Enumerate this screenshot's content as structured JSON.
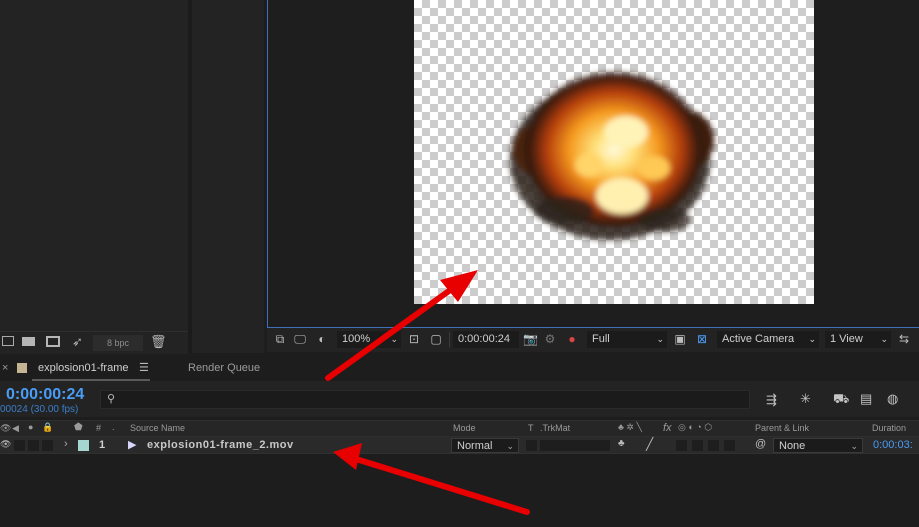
{
  "project": {
    "bit_depth": "8 bpc"
  },
  "viewer": {
    "zoom": "100%",
    "timecode": "0:00:00:24",
    "resolution": "Full",
    "camera": "Active Camera",
    "views": "1 View"
  },
  "timeline": {
    "close_glyph": "×",
    "comp_tab": "explosion01-frame",
    "render_queue_tab": "Render Queue",
    "menu_glyph": "☰",
    "current_time": "0:00:00:24",
    "frame_info": "00024 (30.00 fps)",
    "search_placeholder": "",
    "columns": {
      "hash": "#",
      "dot": ".",
      "source_name": "Source Name",
      "mode": "Mode",
      "t": "T",
      "trkmat": ".TrkMat",
      "fx": "fx",
      "parent_link": "Parent & Link",
      "duration": "Duration"
    },
    "layer": {
      "index": "1",
      "name": "explosion01-frame_2.mov",
      "mode": "Normal",
      "parent": "None",
      "duration": "0:00:03:"
    }
  },
  "colors": {
    "accent_blue": "#4a9cf5",
    "label_teal": "#a5d6d0",
    "label_tan": "#c4b494",
    "annotation_red": "#e80000"
  }
}
